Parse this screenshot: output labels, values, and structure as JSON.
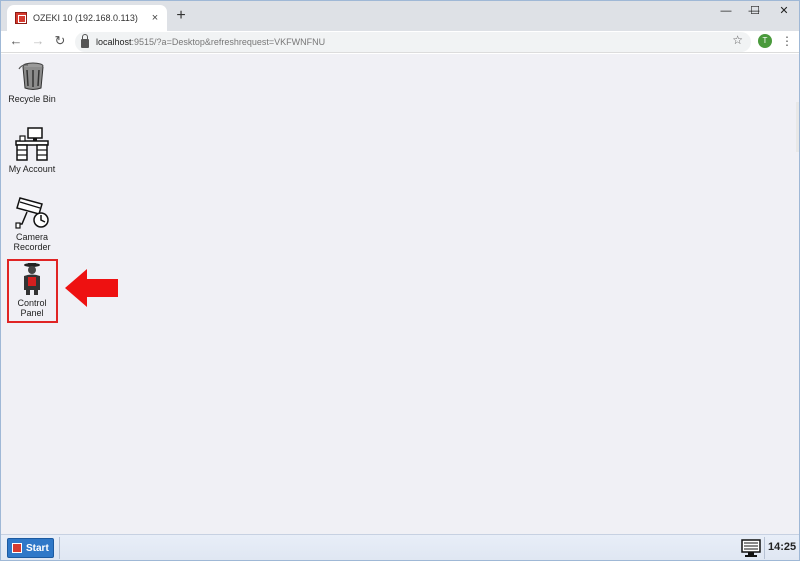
{
  "browser": {
    "tab_title": "OZEKI 10 (192.168.0.113)",
    "tab_close": "×",
    "new_tab": "+",
    "window_controls": {
      "minimize": "—",
      "maximize": "☐",
      "close": "✕"
    },
    "nav": {
      "back": "←",
      "forward": "→",
      "reload": "↻"
    },
    "url_host": "localhost",
    "url_path": ":9515/?a=Desktop&refreshrequest=VKFWNFNU",
    "star": "☆",
    "profile_initial": "T",
    "menu": "⋮"
  },
  "desktop": {
    "icons": [
      {
        "label": "Recycle Bin",
        "icon": "recycle-bin-icon"
      },
      {
        "label": "My Account",
        "icon": "desk-computer-icon"
      },
      {
        "label_line1": "Camera",
        "label_line2": "Recorder",
        "icon": "security-camera-icon"
      },
      {
        "label_line1": "Control",
        "label_line2": "Panel",
        "icon": "control-panel-person-icon"
      }
    ],
    "highlight_color": "#e02424",
    "arrow_color": "#ee1111"
  },
  "taskbar": {
    "start_label": "Start",
    "clock": "14:25",
    "start_color": "#2f78c8"
  }
}
